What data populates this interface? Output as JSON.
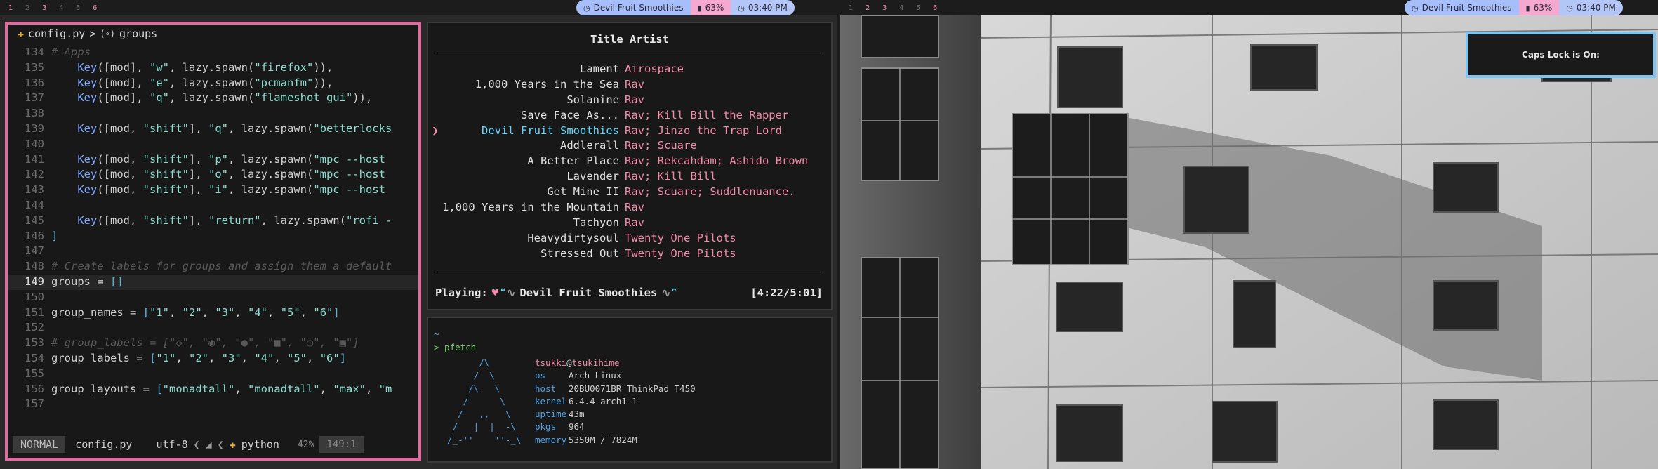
{
  "left_bar": {
    "workspaces": [
      "1",
      "2",
      "3",
      "4",
      "5",
      "6"
    ],
    "song": "Devil Fruit Smoothies",
    "battery": "63%",
    "clock": "03:40 PM"
  },
  "right_bar": {
    "workspaces": [
      "1",
      "2",
      "3",
      "4",
      "5",
      "6"
    ],
    "song": "Devil Fruit Smoothies",
    "battery": "63%",
    "clock": "03:40 PM"
  },
  "editor": {
    "breadcrumb_file": "config.py",
    "breadcrumb_sep": ">",
    "breadcrumb_symbol": "groups",
    "lines": [
      {
        "n": "134",
        "parts": [
          {
            "t": "# Apps",
            "c": "com"
          }
        ]
      },
      {
        "n": "135",
        "parts": [
          {
            "t": "    ",
            "c": "txt"
          },
          {
            "t": "Key",
            "c": "key"
          },
          {
            "t": "([mod], ",
            "c": "txt"
          },
          {
            "t": "\"w\"",
            "c": "str"
          },
          {
            "t": ", lazy.spawn(",
            "c": "txt"
          },
          {
            "t": "\"firefox\"",
            "c": "str"
          },
          {
            "t": ")),",
            "c": "txt"
          }
        ]
      },
      {
        "n": "136",
        "parts": [
          {
            "t": "    ",
            "c": "txt"
          },
          {
            "t": "Key",
            "c": "key"
          },
          {
            "t": "([mod], ",
            "c": "txt"
          },
          {
            "t": "\"e\"",
            "c": "str"
          },
          {
            "t": ", lazy.spawn(",
            "c": "txt"
          },
          {
            "t": "\"pcmanfm\"",
            "c": "str"
          },
          {
            "t": ")),",
            "c": "txt"
          }
        ]
      },
      {
        "n": "137",
        "parts": [
          {
            "t": "    ",
            "c": "txt"
          },
          {
            "t": "Key",
            "c": "key"
          },
          {
            "t": "([mod], ",
            "c": "txt"
          },
          {
            "t": "\"q\"",
            "c": "str"
          },
          {
            "t": ", lazy.spawn(",
            "c": "txt"
          },
          {
            "t": "\"flameshot gui\"",
            "c": "str"
          },
          {
            "t": ")),",
            "c": "txt"
          }
        ]
      },
      {
        "n": "138",
        "parts": []
      },
      {
        "n": "139",
        "parts": [
          {
            "t": "    ",
            "c": "txt"
          },
          {
            "t": "Key",
            "c": "key"
          },
          {
            "t": "([mod, ",
            "c": "txt"
          },
          {
            "t": "\"shift\"",
            "c": "str"
          },
          {
            "t": "], ",
            "c": "txt"
          },
          {
            "t": "\"q\"",
            "c": "str"
          },
          {
            "t": ", lazy.spawn(",
            "c": "txt"
          },
          {
            "t": "\"betterlocks",
            "c": "str"
          }
        ]
      },
      {
        "n": "140",
        "parts": []
      },
      {
        "n": "141",
        "parts": [
          {
            "t": "    ",
            "c": "txt"
          },
          {
            "t": "Key",
            "c": "key"
          },
          {
            "t": "([mod, ",
            "c": "txt"
          },
          {
            "t": "\"shift\"",
            "c": "str"
          },
          {
            "t": "], ",
            "c": "txt"
          },
          {
            "t": "\"p\"",
            "c": "str"
          },
          {
            "t": ", lazy.spawn(",
            "c": "txt"
          },
          {
            "t": "\"mpc --host",
            "c": "str"
          }
        ]
      },
      {
        "n": "142",
        "parts": [
          {
            "t": "    ",
            "c": "txt"
          },
          {
            "t": "Key",
            "c": "key"
          },
          {
            "t": "([mod, ",
            "c": "txt"
          },
          {
            "t": "\"shift\"",
            "c": "str"
          },
          {
            "t": "], ",
            "c": "txt"
          },
          {
            "t": "\"o\"",
            "c": "str"
          },
          {
            "t": ", lazy.spawn(",
            "c": "txt"
          },
          {
            "t": "\"mpc --host",
            "c": "str"
          }
        ]
      },
      {
        "n": "143",
        "parts": [
          {
            "t": "    ",
            "c": "txt"
          },
          {
            "t": "Key",
            "c": "key"
          },
          {
            "t": "([mod, ",
            "c": "txt"
          },
          {
            "t": "\"shift\"",
            "c": "str"
          },
          {
            "t": "], ",
            "c": "txt"
          },
          {
            "t": "\"i\"",
            "c": "str"
          },
          {
            "t": ", lazy.spawn(",
            "c": "txt"
          },
          {
            "t": "\"mpc --host",
            "c": "str"
          }
        ]
      },
      {
        "n": "144",
        "parts": []
      },
      {
        "n": "145",
        "parts": [
          {
            "t": "    ",
            "c": "txt"
          },
          {
            "t": "Key",
            "c": "key"
          },
          {
            "t": "([mod, ",
            "c": "txt"
          },
          {
            "t": "\"shift\"",
            "c": "str"
          },
          {
            "t": "], ",
            "c": "txt"
          },
          {
            "t": "\"return\"",
            "c": "str"
          },
          {
            "t": ", lazy.spawn(",
            "c": "txt"
          },
          {
            "t": "\"rofi -",
            "c": "str"
          }
        ]
      },
      {
        "n": "146",
        "parts": [
          {
            "t": "]",
            "c": "brk"
          }
        ]
      },
      {
        "n": "147",
        "parts": []
      },
      {
        "n": "148",
        "parts": [
          {
            "t": "# Create labels for groups and assign them a default",
            "c": "com"
          }
        ]
      },
      {
        "n": "149",
        "cur": true,
        "parts": [
          {
            "t": "g",
            "c": "cursor"
          },
          {
            "t": "roups = ",
            "c": "txt"
          },
          {
            "t": "[]",
            "c": "brk"
          }
        ]
      },
      {
        "n": "150",
        "parts": []
      },
      {
        "n": "151",
        "parts": [
          {
            "t": "group_names = ",
            "c": "txt"
          },
          {
            "t": "[",
            "c": "brk"
          },
          {
            "t": "\"1\"",
            "c": "str"
          },
          {
            "t": ", ",
            "c": "txt"
          },
          {
            "t": "\"2\"",
            "c": "str"
          },
          {
            "t": ", ",
            "c": "txt"
          },
          {
            "t": "\"3\"",
            "c": "str"
          },
          {
            "t": ", ",
            "c": "txt"
          },
          {
            "t": "\"4\"",
            "c": "str"
          },
          {
            "t": ", ",
            "c": "txt"
          },
          {
            "t": "\"5\"",
            "c": "str"
          },
          {
            "t": ", ",
            "c": "txt"
          },
          {
            "t": "\"6\"",
            "c": "str"
          },
          {
            "t": "]",
            "c": "brk"
          }
        ]
      },
      {
        "n": "152",
        "parts": []
      },
      {
        "n": "153",
        "parts": [
          {
            "t": "# group_labels = [\"◇\", \"◉\", \"●\", \"■\", \"○\", \"▣\"]",
            "c": "com"
          }
        ]
      },
      {
        "n": "154",
        "parts": [
          {
            "t": "group_labels = ",
            "c": "txt"
          },
          {
            "t": "[",
            "c": "brk"
          },
          {
            "t": "\"1\"",
            "c": "str"
          },
          {
            "t": ", ",
            "c": "txt"
          },
          {
            "t": "\"2\"",
            "c": "str"
          },
          {
            "t": ", ",
            "c": "txt"
          },
          {
            "t": "\"3\"",
            "c": "str"
          },
          {
            "t": ", ",
            "c": "txt"
          },
          {
            "t": "\"4\"",
            "c": "str"
          },
          {
            "t": ", ",
            "c": "txt"
          },
          {
            "t": "\"5\"",
            "c": "str"
          },
          {
            "t": ", ",
            "c": "txt"
          },
          {
            "t": "\"6\"",
            "c": "str"
          },
          {
            "t": "]",
            "c": "brk"
          }
        ]
      },
      {
        "n": "155",
        "parts": []
      },
      {
        "n": "156",
        "parts": [
          {
            "t": "group_layouts = ",
            "c": "txt"
          },
          {
            "t": "[",
            "c": "brk"
          },
          {
            "t": "\"monadtall\"",
            "c": "str"
          },
          {
            "t": ", ",
            "c": "txt"
          },
          {
            "t": "\"monadtall\"",
            "c": "str"
          },
          {
            "t": ", ",
            "c": "txt"
          },
          {
            "t": "\"max\"",
            "c": "str"
          },
          {
            "t": ", ",
            "c": "txt"
          },
          {
            "t": "\"m",
            "c": "str"
          }
        ]
      },
      {
        "n": "157",
        "parts": []
      }
    ],
    "status": {
      "mode": "NORMAL",
      "file": "config.py",
      "encoding": "utf-8",
      "language": "python",
      "percent": "42%",
      "position": "149:1"
    }
  },
  "player": {
    "header": "Title Artist",
    "tracks": [
      {
        "title": "Lament",
        "artist": "Airospace"
      },
      {
        "title": "1,000 Years in the Sea",
        "artist": "Rav"
      },
      {
        "title": "Solanine",
        "artist": "Rav"
      },
      {
        "title": "Save Face As...",
        "artist": "Rav; Kill Bill the Rapper"
      },
      {
        "title": "Devil Fruit Smoothies",
        "artist": "Rav; Jinzo the Trap Lord",
        "selected": true
      },
      {
        "title": "Addlerall",
        "artist": "Rav; Scuare"
      },
      {
        "title": "A Better Place",
        "artist": "Rav; Rekcahdam; Ashido Brown"
      },
      {
        "title": "Lavender",
        "artist": "Rav; Kill Bill"
      },
      {
        "title": "Get Mine II",
        "artist": "Rav; Scuare; Suddlenuance."
      },
      {
        "title": "1,000 Years in the Mountain",
        "artist": "Rav"
      },
      {
        "title": "Tachyon",
        "artist": "Rav"
      },
      {
        "title": "Heavydirtysoul",
        "artist": "Twenty One Pilots"
      },
      {
        "title": "Stressed Out",
        "artist": "Twenty One Pilots"
      }
    ],
    "now_label": "Playing:",
    "now_title": "Devil Fruit Smoothies",
    "time": "[4:22/5:01]"
  },
  "terminal": {
    "tilde": "~",
    "prompt": "> pfetch",
    "logo": "        /\\\n       /  \\\n      /\\   \\\n     /      \\\n    /   ,,   \\\n   /   |  |  -\\\n  /_-''    ''-_\\",
    "user": "tsukki",
    "at": "@",
    "host": "tsukihime",
    "info": [
      {
        "k": "os",
        "v": "Arch Linux"
      },
      {
        "k": "host",
        "v": "20BU0071BR ThinkPad T450"
      },
      {
        "k": "kernel",
        "v": "6.4.4-arch1-1"
      },
      {
        "k": "uptime",
        "v": "43m"
      },
      {
        "k": "pkgs",
        "v": "964"
      },
      {
        "k": "memory",
        "v": "5350M / 7824M"
      }
    ]
  },
  "notification": {
    "text": "Caps Lock is On:"
  },
  "colors": {
    "accent_pink": "#f38ba8",
    "focus_border": "#e06c9f",
    "cyan": "#5fd7ff",
    "notif_border": "#7fc4ee"
  }
}
